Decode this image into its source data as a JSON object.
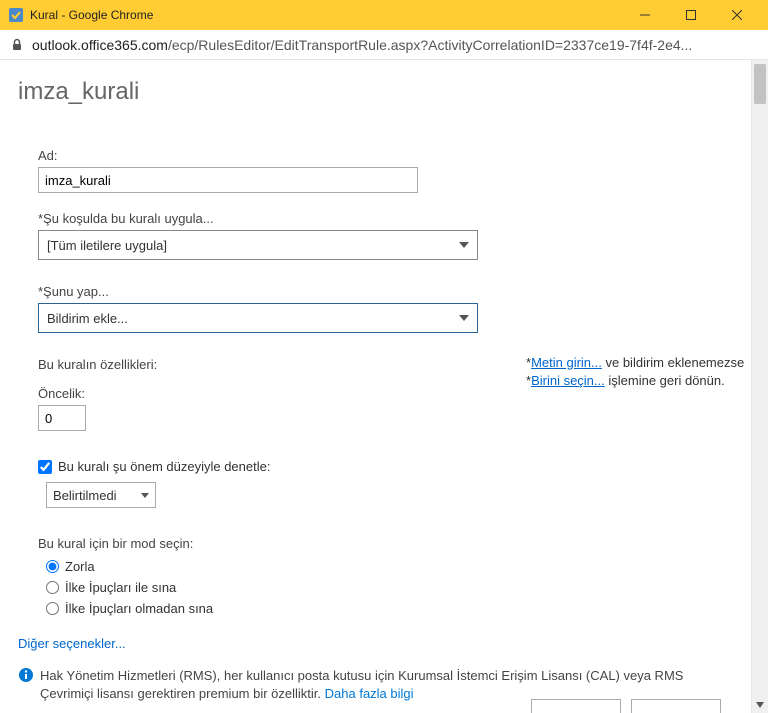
{
  "window": {
    "title": "Kural - Google Chrome"
  },
  "address": {
    "host": "outlook.office365.com",
    "path": "/ecp/RulesEditor/EditTransportRule.aspx?ActivityCorrelationID=2337ce19-7f4f-2e4..."
  },
  "page": {
    "heading": "imza_kurali"
  },
  "form": {
    "name_label": "Ad:",
    "name_value": "imza_kurali",
    "condition_label": "*Şu koşulda bu kuralı uygula...",
    "condition_value": "[Tüm iletilere uygula]",
    "action_label": "*Şunu yap...",
    "action_value": "Bildirim ekle...",
    "sidenote_prefix1": "*",
    "sidenote_link1": "Metin girin...",
    "sidenote_rest1": " ve bildirim eklenemezse",
    "sidenote_prefix2": "*",
    "sidenote_link2": "Birini seçin...",
    "sidenote_rest2": " işlemine geri dönün.",
    "properties_label": "Bu kuralın özellikleri:",
    "priority_label": "Öncelik:",
    "priority_value": "0",
    "audit_checkbox_label": "Bu kuralı şu önem düzeyiyle denetle:",
    "audit_checked": true,
    "audit_level_value": "Belirtilmedi",
    "mode_label": "Bu kural için bir mod seçin:",
    "mode_options": [
      {
        "label": "Zorla",
        "checked": true
      },
      {
        "label": "İlke İpuçları ile sına",
        "checked": false
      },
      {
        "label": "İlke İpuçları olmadan sına",
        "checked": false
      }
    ],
    "more_options": "Diğer seçenekler..."
  },
  "footer": {
    "text": "Hak Yönetim Hizmetleri (RMS), her kullanıcı posta kutusu için Kurumsal İstemci Erişim Lisansı (CAL) veya RMS Çevrimiçi lisansı gerektiren premium bir özelliktir. ",
    "link": "Daha fazla bilgi"
  }
}
